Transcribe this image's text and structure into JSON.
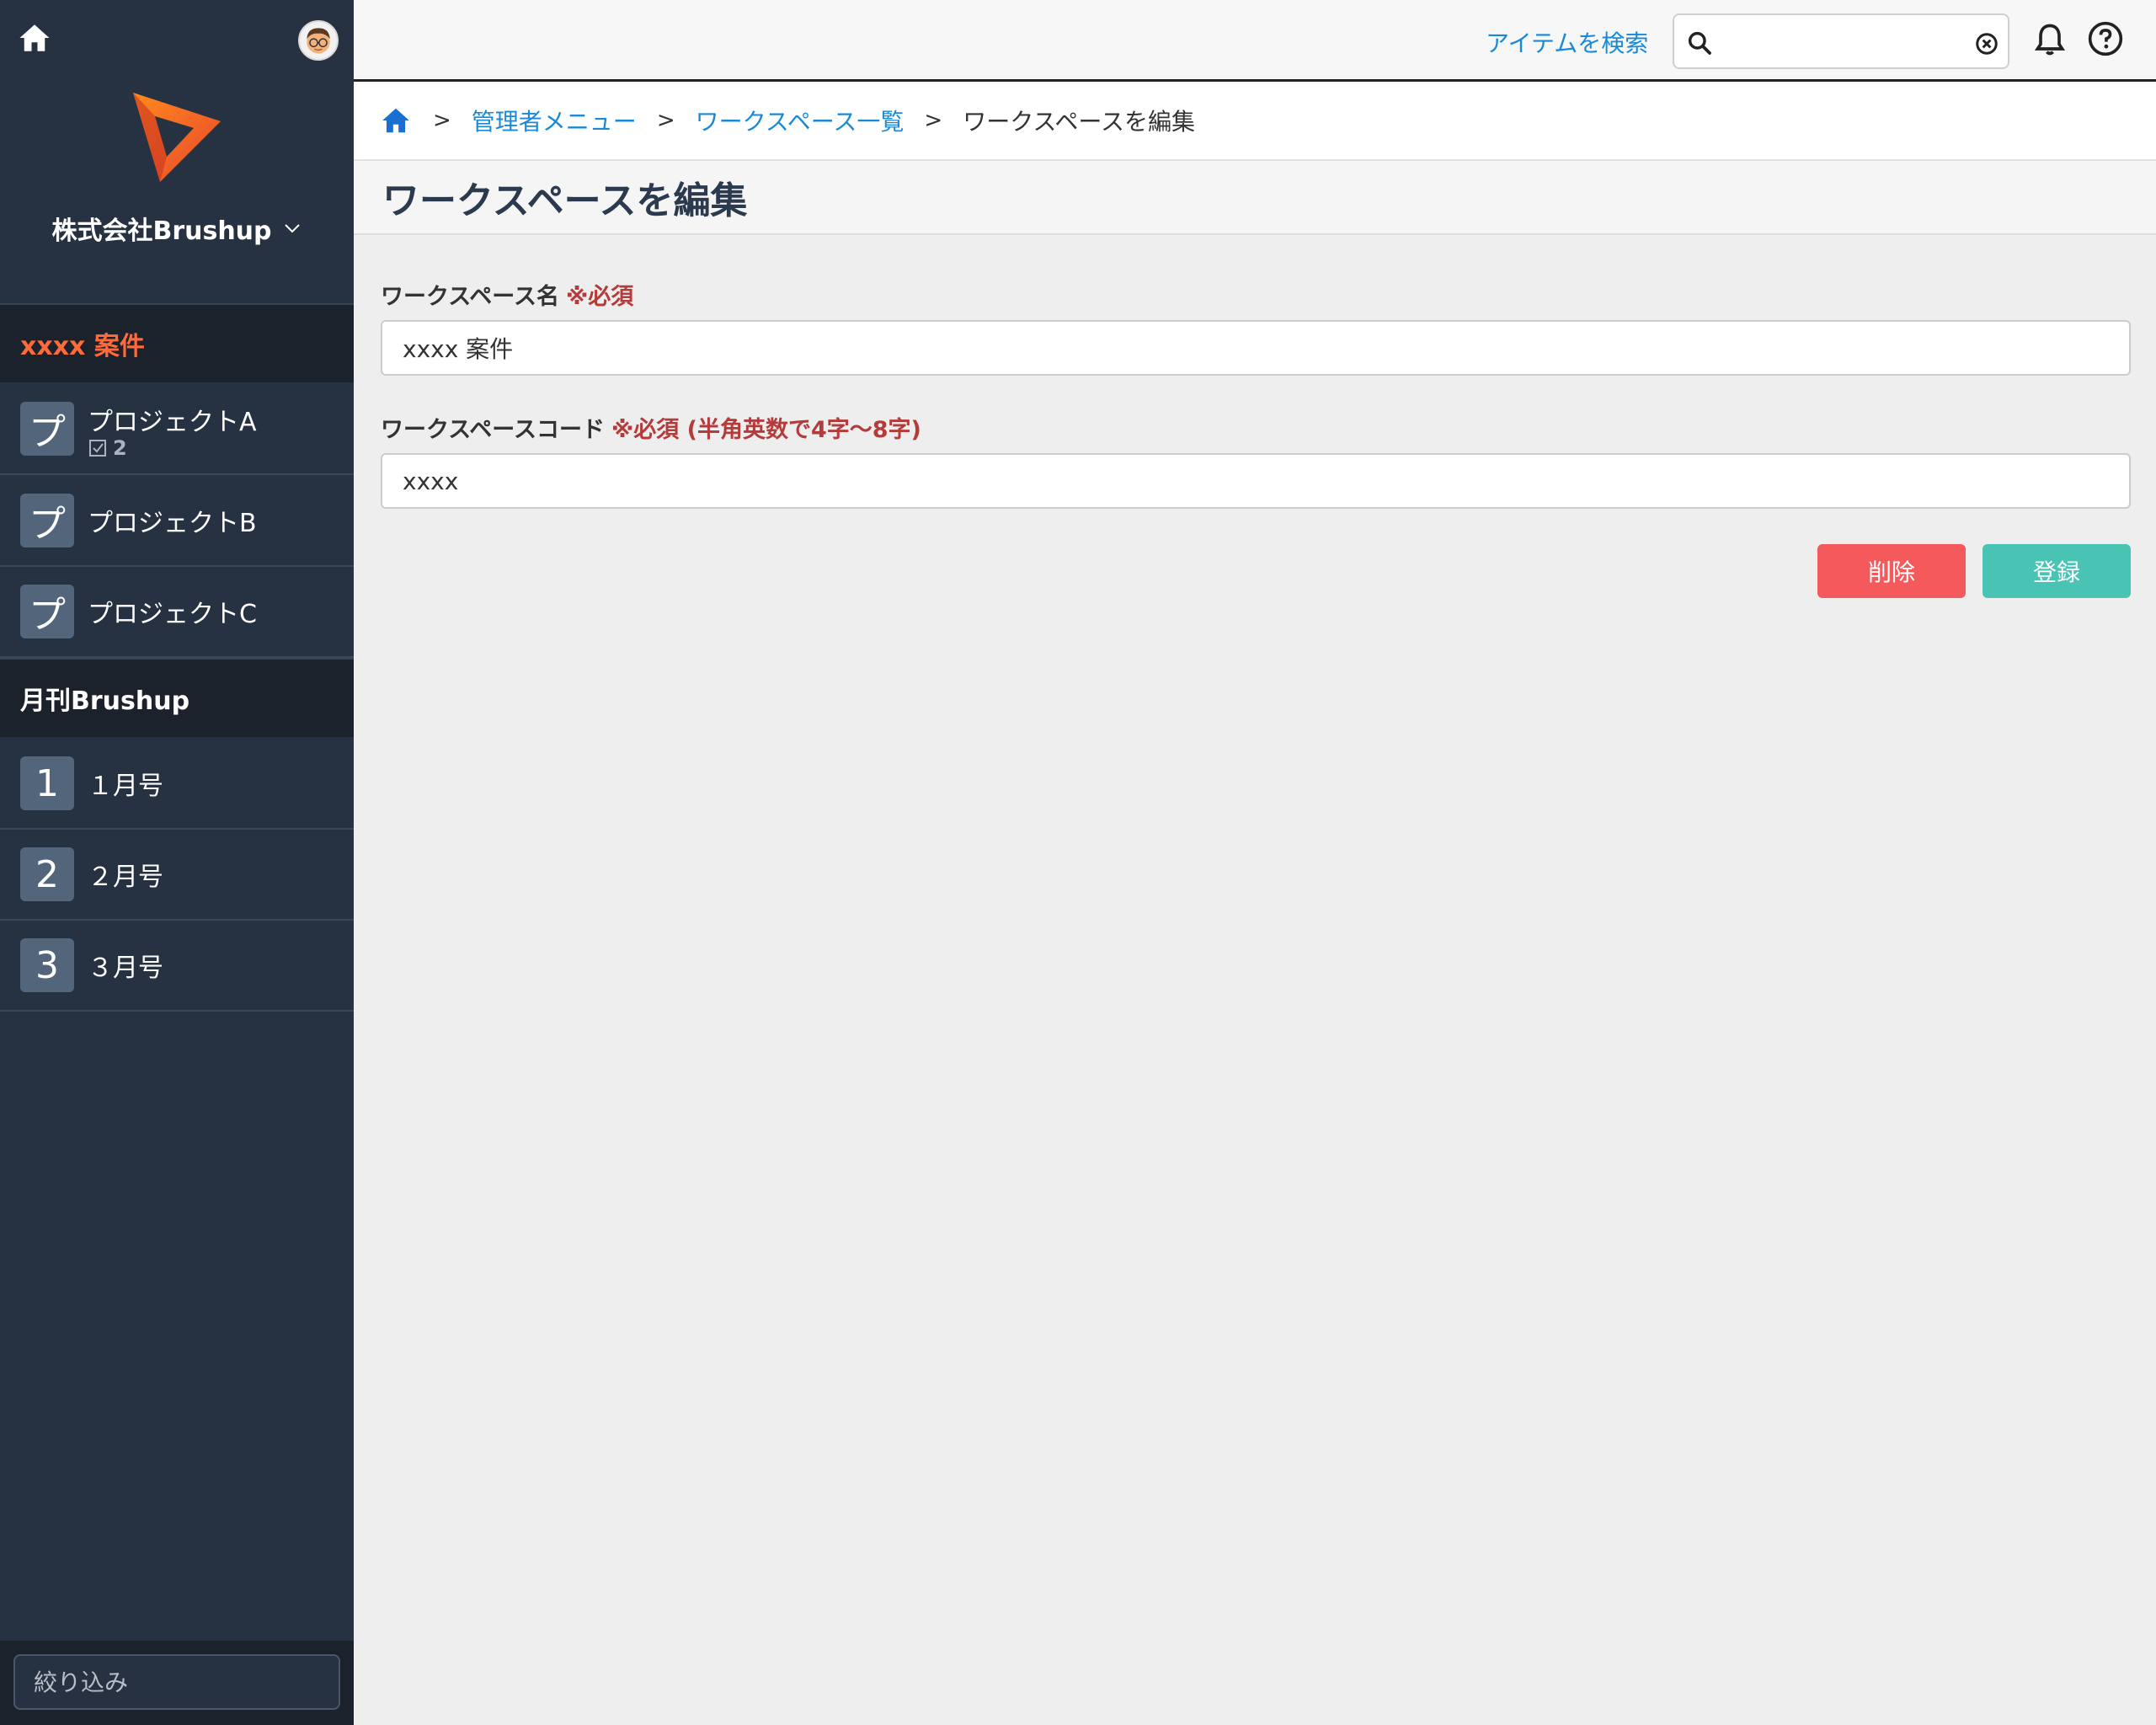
{
  "sidebar": {
    "org_name": "株式会社Brushup",
    "groups": [
      {
        "name": "xxxx 案件",
        "items": [
          {
            "badge": "プ",
            "label": "プロジェクトA",
            "count": "2"
          },
          {
            "badge": "プ",
            "label": "プロジェクトB"
          },
          {
            "badge": "プ",
            "label": "プロジェクトC"
          }
        ]
      },
      {
        "name": "月刊Brushup",
        "items": [
          {
            "badge": "1",
            "label": "１月号"
          },
          {
            "badge": "2",
            "label": "２月号"
          },
          {
            "badge": "3",
            "label": "３月号"
          }
        ]
      }
    ],
    "filter_placeholder": "絞り込み"
  },
  "topbar": {
    "search_link": "アイテムを検索",
    "search_value": ""
  },
  "breadcrumb": {
    "items": [
      "管理者メニュー",
      "ワークスペース一覧"
    ],
    "current": "ワークスペースを編集",
    "separator": ">"
  },
  "page": {
    "title": "ワークスペースを編集"
  },
  "form": {
    "name_label": "ワークスペース名",
    "name_required": "※必須",
    "name_value": "xxxx 案件",
    "code_label": "ワークスペースコード",
    "code_required": "※必須 (半角英数で4字〜8字)",
    "code_value": "xxxx",
    "delete_label": "削除",
    "save_label": "登録"
  },
  "colors": {
    "sidebar_bg": "#263241",
    "accent_orange": "#ff6a3a",
    "link_blue": "#1a8ad8",
    "required_red": "#b53a3a",
    "delete_red": "#f4595c",
    "save_teal": "#48c3b4"
  }
}
